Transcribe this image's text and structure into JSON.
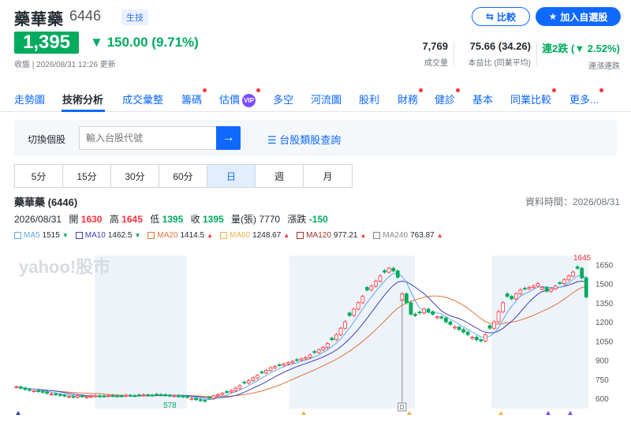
{
  "header": {
    "name": "藥華藥",
    "code": "6446",
    "tag": "生技",
    "compare_label": "比較",
    "watch_label": "加入自選股"
  },
  "quote": {
    "price": "1,395",
    "change": "150.00 (9.71%)",
    "status_line": "收盤 | 2026/08/31 12:26 更新",
    "stats": [
      {
        "value": "7,769",
        "label": "成交量"
      },
      {
        "value": "75.66 (34.26)",
        "label": "本益比 (同業平均)"
      },
      {
        "value": "連2跌 (▼ 2.52%)",
        "label": "連漲連跌"
      }
    ]
  },
  "nav": {
    "items": [
      "走勢圖",
      "技術分析",
      "成交彙整",
      "籌碼",
      "估價",
      "多空",
      "河流圖",
      "股利",
      "財務",
      "健診",
      "基本",
      "同業比較",
      "更多..."
    ],
    "vip": "VIP",
    "active": "技術分析"
  },
  "search": {
    "label": "切換個股",
    "placeholder": "輸入台股代號",
    "link": "台股類股查詢"
  },
  "periods": {
    "items": [
      "5分",
      "15分",
      "30分",
      "60分",
      "日",
      "週",
      "月"
    ],
    "active": "日"
  },
  "chart_info": {
    "title": "藥華藥 (6446)",
    "data_time": "資料時間：2026/08/31",
    "date": "2026/08/31",
    "open_label": "開",
    "open": "1630",
    "high_label": "高",
    "high": "1645",
    "low_label": "低",
    "low": "1395",
    "close_label": "收",
    "close": "1395",
    "vol_label": "量(張)",
    "vol": "7770",
    "chg_label": "漲跌",
    "chg": "-150"
  },
  "ma": [
    {
      "name": "MA5",
      "value": "1515",
      "dir": "down",
      "color": "#5fa7e8"
    },
    {
      "name": "MA10",
      "value": "1462.5",
      "dir": "down",
      "color": "#3b3fb5"
    },
    {
      "name": "MA20",
      "value": "1414.5",
      "dir": "up",
      "color": "#e0723a"
    },
    {
      "name": "MA60",
      "value": "1248.67",
      "dir": "up",
      "color": "#f0b34a"
    },
    {
      "name": "MA120",
      "value": "977.21",
      "dir": "up",
      "color": "#a0312a"
    },
    {
      "name": "MA240",
      "value": "763.87",
      "dir": "up",
      "color": "#888888"
    }
  ],
  "colors": {
    "up": "#ff333a",
    "down": "#00ab5e",
    "accent": "#0f69ff"
  },
  "chart_data": {
    "type": "candlestick",
    "watermark": "yahoo!股市",
    "y_ticks": [
      600,
      750,
      900,
      1050,
      1200,
      1350,
      1500,
      1650
    ],
    "ylim": [
      520,
      1720
    ],
    "high_label": "1645",
    "low_label": "578",
    "marker_label": "D",
    "closes": [
      690,
      680,
      670,
      665,
      660,
      655,
      650,
      640,
      635,
      630,
      625,
      620,
      615,
      610,
      620,
      615,
      612,
      618,
      620,
      615,
      618,
      622,
      620,
      618,
      620,
      625,
      622,
      620,
      625,
      628,
      626,
      624,
      630,
      628,
      625,
      622,
      620,
      618,
      615,
      610,
      600,
      590,
      585,
      578,
      600,
      620,
      630,
      640,
      650,
      660,
      680,
      700,
      720,
      740,
      760,
      780,
      800,
      820,
      840,
      850,
      860,
      870,
      880,
      890,
      900,
      910,
      920,
      940,
      960,
      980,
      1000,
      1030,
      1060,
      1100,
      1150,
      1200,
      1250,
      1300,
      1350,
      1400,
      1450,
      1480,
      1520,
      1560,
      1590,
      1620,
      1600,
      1550,
      1420,
      1350,
      1260,
      1250,
      1270,
      1300,
      1280,
      1260,
      1240,
      1230,
      1200,
      1180,
      1160,
      1140,
      1120,
      1100,
      1080,
      1060,
      1050,
      1100,
      1150,
      1200,
      1280,
      1350,
      1400,
      1380,
      1420,
      1450,
      1460,
      1470,
      1480,
      1500,
      1470,
      1440,
      1460,
      1480,
      1500,
      1530,
      1560,
      1590,
      1620,
      1545,
      1395
    ]
  }
}
